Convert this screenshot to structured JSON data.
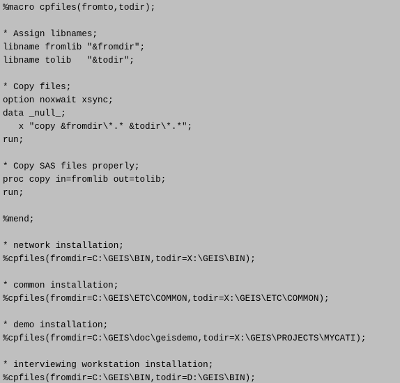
{
  "lines": [
    "%macro cpfiles(fromto,todir);",
    "",
    "* Assign libnames;",
    "libname fromlib \"&fromdir\";",
    "libname tolib   \"&todir\";",
    "",
    "* Copy files;",
    "option noxwait xsync;",
    "data _null_;",
    "   x \"copy &fromdir\\*.* &todir\\*.*\";",
    "run;",
    "",
    "* Copy SAS files properly;",
    "proc copy in=fromlib out=tolib;",
    "run;",
    "",
    "%mend;",
    "",
    "* network installation;",
    "%cpfiles(fromdir=C:\\GEIS\\BIN,todir=X:\\GEIS\\BIN);",
    "",
    "* common installation;",
    "%cpfiles(fromdir=C:\\GEIS\\ETC\\COMMON,todir=X:\\GEIS\\ETC\\COMMON);",
    "",
    "* demo installation;",
    "%cpfiles(fromdir=C:\\GEIS\\doc\\geisdemo,todir=X:\\GEIS\\PROJECTS\\MYCATI);",
    "",
    "* interviewing workstation installation;",
    "%cpfiles(fromdir=C:\\GEIS\\BIN,todir=D:\\GEIS\\BIN);"
  ]
}
